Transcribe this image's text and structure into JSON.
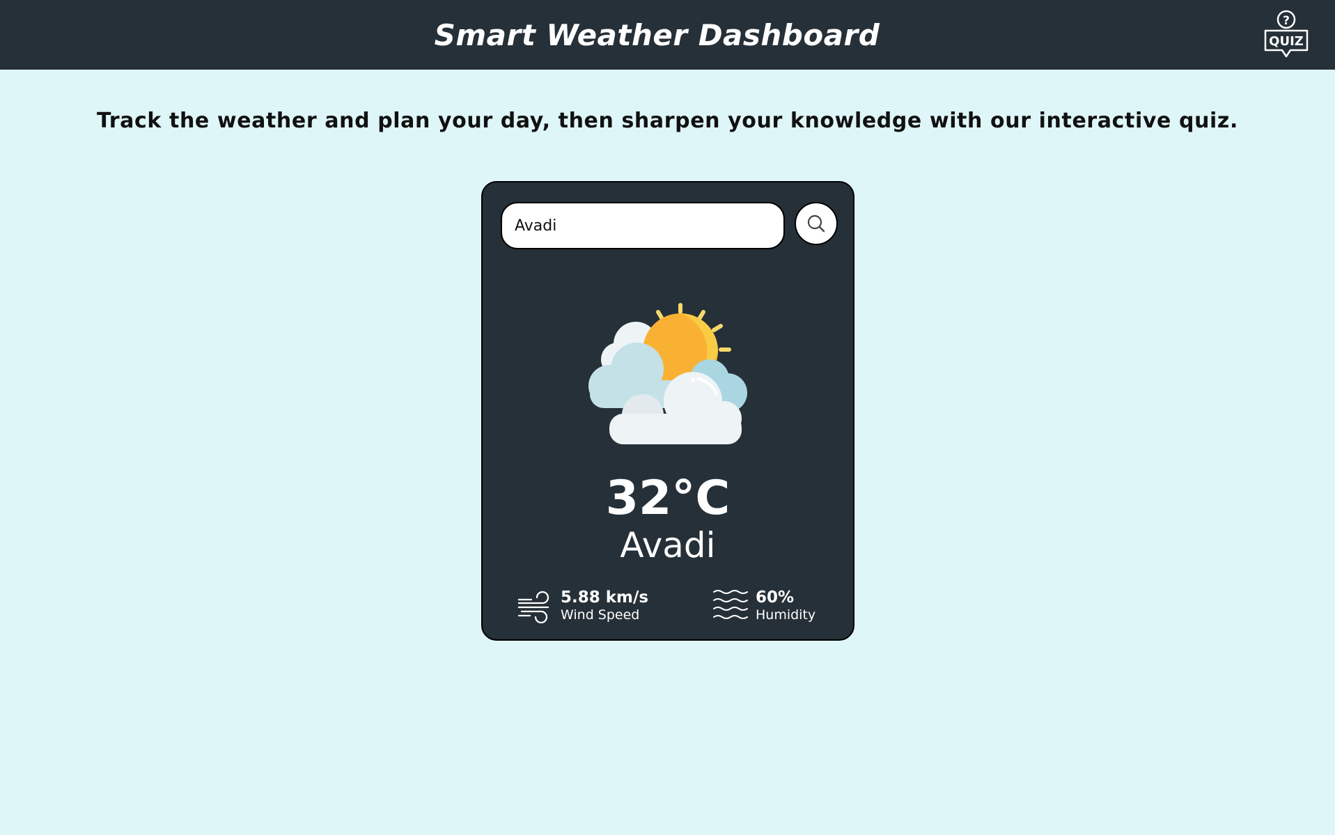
{
  "header": {
    "title": "Smart Weather Dashboard",
    "quiz_label": "QUIZ",
    "quiz_icon": "question-bubble-icon"
  },
  "tagline": "Track the weather and plan your day, then sharpen your knowledge with our interactive quiz.",
  "search": {
    "value": "Avadi",
    "button_icon": "search-icon"
  },
  "weather": {
    "icon": "partly-cloudy-sun-icon",
    "temperature": "32°C",
    "city": "Avadi",
    "wind": {
      "value": "5.88 km/s",
      "label": "Wind Speed",
      "icon": "wind-icon"
    },
    "humidity": {
      "value": "60%",
      "label": "Humidity",
      "icon": "humidity-waves-icon"
    }
  },
  "colors": {
    "background": "#dff6f8",
    "header_bg": "#263038",
    "card_bg": "#263038",
    "sun": "#f9b134",
    "cloud_light": "#eef3f6",
    "cloud_blue": "#a9d6e0"
  }
}
